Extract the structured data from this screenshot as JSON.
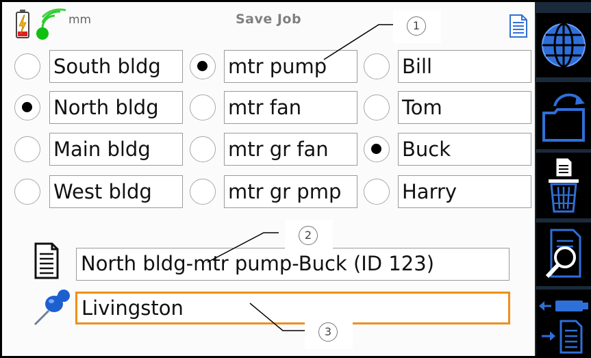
{
  "header": {
    "title": "Save Job",
    "unit": "mm"
  },
  "locations": [
    {
      "label": "South bldg",
      "selected": false
    },
    {
      "label": "North bldg",
      "selected": true
    },
    {
      "label": "Main bldg",
      "selected": false
    },
    {
      "label": "West bldg",
      "selected": false
    }
  ],
  "machines": [
    {
      "label": "mtr pump",
      "selected": true
    },
    {
      "label": "mtr fan",
      "selected": false
    },
    {
      "label": "mtr gr fan",
      "selected": false
    },
    {
      "label": "mtr gr pmp",
      "selected": false
    }
  ],
  "operators": [
    {
      "label": "Bill",
      "selected": false
    },
    {
      "label": "Tom",
      "selected": false
    },
    {
      "label": "Buck",
      "selected": true
    },
    {
      "label": "Harry",
      "selected": false
    }
  ],
  "job_name": {
    "value": "North bldg-mtr pump-Buck (ID 123)"
  },
  "site": {
    "value": "Livingston"
  },
  "callouts": [
    "1",
    "2",
    "3"
  ],
  "colors": {
    "accent": "#ef8f1a",
    "icon_blue": "#2e6fd6",
    "sidebar": "#000000"
  },
  "icons": [
    "battery-icon",
    "signal-icon",
    "document-icon",
    "globe-icon",
    "open-folder-icon",
    "trash-document-icon",
    "search-document-icon",
    "transfer-icon",
    "pin-icon"
  ]
}
